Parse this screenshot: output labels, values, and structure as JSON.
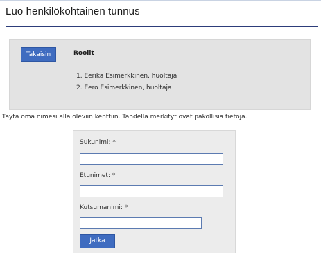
{
  "page": {
    "title": "Luo henkilökohtainen tunnus"
  },
  "roles": {
    "back_label": "Takaisin",
    "heading": "Roolit",
    "items": [
      "1. Eerika Esimerkkinen, huoltaja",
      "2. Eero Esimerkkinen, huoltaja"
    ]
  },
  "instructions": "Täytä oma nimesi alla oleviin kenttiin. Tähdellä merkityt ovat pakollisia tietoja.",
  "form": {
    "surname_label": "Sukunimi: *",
    "surname_value": "",
    "firstnames_label": "Etunimet: *",
    "firstnames_value": "",
    "nickname_label": "Kutsumanimi: *",
    "nickname_value": "",
    "submit_label": "Jatka"
  }
}
